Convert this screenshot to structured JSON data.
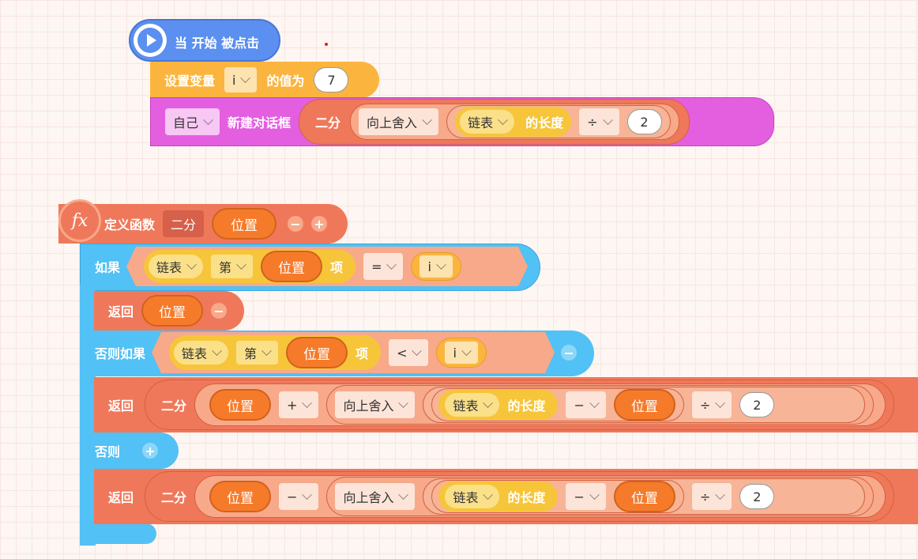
{
  "event": {
    "title": "当 开始 被点击"
  },
  "setvar": {
    "label": "设置变量",
    "var": "i",
    "mid": "的值为",
    "value": "7"
  },
  "dialog": {
    "target": "自己",
    "label": "新建对话框",
    "func": "二分",
    "round": "向上舍入",
    "list": "链表",
    "length": "的长度",
    "op": "÷",
    "num": "2"
  },
  "define": {
    "icon": "fx",
    "label": "定义函数",
    "name": "二分",
    "param": "位置",
    "minus": "−",
    "plus": "+"
  },
  "if1": {
    "label": "如果",
    "list": "链表",
    "nth": "第",
    "pos": "位置",
    "item": "项",
    "op": "=",
    "var": "i"
  },
  "ret1": {
    "label": "返回",
    "value": "位置",
    "minus": "−"
  },
  "elif": {
    "label": "否则如果",
    "list": "链表",
    "nth": "第",
    "pos": "位置",
    "item": "项",
    "op": "<",
    "var": "i",
    "minus": "−"
  },
  "ret2": {
    "label": "返回",
    "func": "二分",
    "pos": "位置",
    "op1": "+",
    "round": "向上舍入",
    "list": "链表",
    "length": "的长度",
    "op2": "−",
    "pos2": "位置",
    "op3": "÷",
    "num": "2"
  },
  "else": {
    "label": "否则",
    "plus": "+"
  },
  "ret3": {
    "label": "返回",
    "func": "二分",
    "pos": "位置",
    "op1": "−",
    "round": "向上舍入",
    "list": "链表",
    "length": "的长度",
    "op2": "−",
    "pos2": "位置",
    "op3": "÷",
    "num": "2"
  },
  "colors": {
    "event": "#5b8ff0",
    "variable": "#fbb53f",
    "looks": "#e35fe0",
    "function": "#f0785a",
    "control": "#52c1f5",
    "operator": "#f7a98a",
    "list": "#f7c53a"
  }
}
